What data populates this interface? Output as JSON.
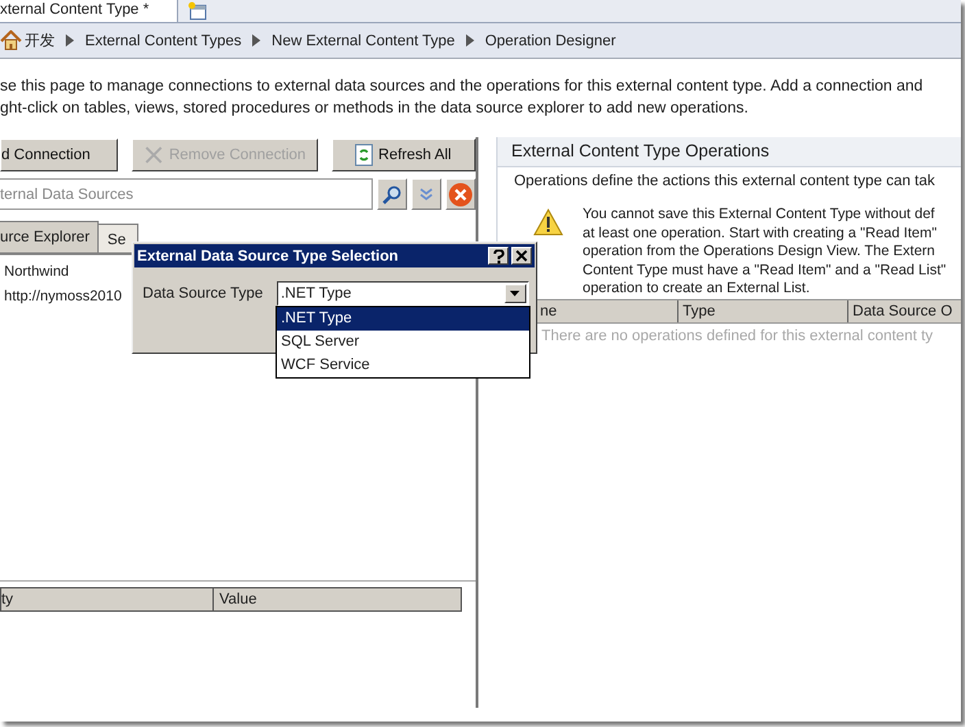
{
  "document_tabs": [
    {
      "label": "xternal Content Type *",
      "selected": true
    }
  ],
  "breadcrumb": [
    "开发",
    "External Content Types",
    "New External Content Type",
    "Operation Designer"
  ],
  "description": [
    "se this page to manage connections to external data sources and the operations for this external content type. Add a connection and",
    "ght-click on tables, views, stored procedures or methods in the data source explorer to add new operations."
  ],
  "toolbar": [
    {
      "kind": "add",
      "label": "d Connection",
      "disabled": false
    },
    {
      "kind": "remove",
      "label": "Remove Connection",
      "disabled": true
    },
    {
      "kind": "refresh",
      "label": "Refresh All",
      "disabled": false
    }
  ],
  "search": {
    "placeholder": "ternal Data Sources"
  },
  "explorer_tabs": [
    {
      "label": "urce Explorer",
      "selected": true
    },
    {
      "label": "Se",
      "selected": false
    }
  ],
  "tree": [
    "Northwind",
    "http://nymoss2010"
  ],
  "property_grid": {
    "columns": [
      "ty",
      "Value"
    ]
  },
  "operations": {
    "title": "External Content Type Operations",
    "description": "Operations define the actions this external content type can tak",
    "warning": [
      "You cannot save this External Content Type without def",
      "at least one operation. Start with creating a \"Read Item\"",
      "operation from the Operations Design View. The Extern",
      "Content Type must have a \"Read Item\" and a \"Read List\"",
      "operation to create an External List."
    ],
    "columns": [
      "ne",
      "Type",
      "Data Source O"
    ],
    "empty_message": "There are no operations defined for this external content ty"
  },
  "dialog": {
    "title": "External Data Source Type Selection",
    "field_label": "Data Source Type",
    "value": ".NET Type",
    "options": [
      {
        "label": ".NET Type",
        "selected": true
      },
      {
        "label": "SQL Server",
        "selected": false
      },
      {
        "label": "WCF Service",
        "selected": false
      }
    ]
  }
}
